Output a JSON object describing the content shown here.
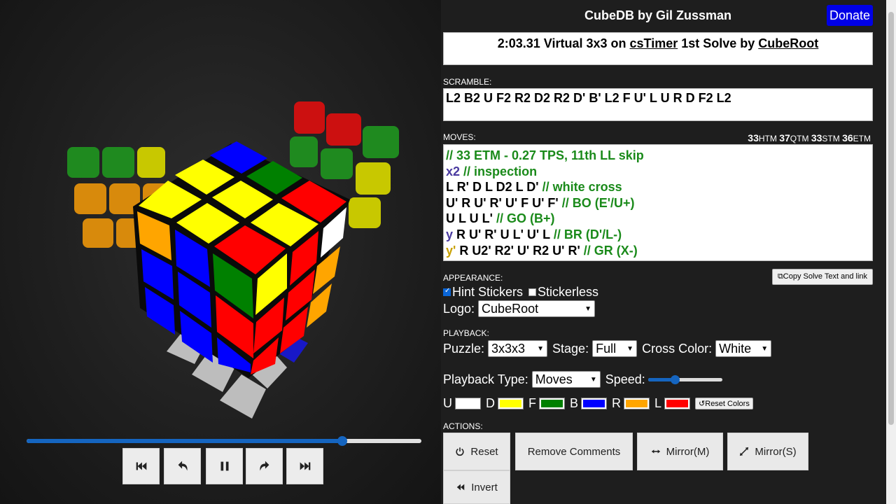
{
  "header": {
    "site_title": "CubeDB by Gil Zussman",
    "donate_label": "Donate"
  },
  "solve": {
    "title_time": "2:03.31 Virtual 3x3 on",
    "title_platform": "csTimer",
    "title_mid": "1st Solve by",
    "title_solver": "CubeRoot"
  },
  "scramble": {
    "label": "SCRAMBLE:",
    "text": "L2 B2 U F2 R2 D2 R2 D' B' L2 F U' L U R D F2 L2"
  },
  "moves": {
    "label": "MOVES:",
    "metrics": [
      {
        "value": "33",
        "unit": "HTM"
      },
      {
        "value": "37",
        "unit": "QTM"
      },
      {
        "value": "33",
        "unit": "STM"
      },
      {
        "value": "36",
        "unit": "ETM"
      }
    ],
    "lines": [
      {
        "prefix": "",
        "moves": "",
        "comment": "// 33 ETM - 0.27 TPS, 11th LL skip"
      },
      {
        "prefix": "x2",
        "moves": "",
        "comment": "// inspection"
      },
      {
        "prefix": "",
        "moves": "L R' D L D2 L D'",
        "comment": "// white cross"
      },
      {
        "prefix": "",
        "moves": "U' R U' R' U' F U' F'",
        "comment": "// BO (E'/U+)"
      },
      {
        "prefix": "",
        "moves": "U L U L'",
        "comment": "// GO (B+)"
      },
      {
        "prefix": "y",
        "moves": "R U' R' U L' U' L",
        "comment": "// BR (D'/L-)"
      },
      {
        "prefix": "y'",
        "moves": "R U2' R2' U' R2 U' R'",
        "comment": "// GR (X-)"
      }
    ]
  },
  "appearance": {
    "label": "APPEARANCE:",
    "copy_label": "Copy Solve Text and link",
    "hint_stickers_label": "Hint Stickers",
    "hint_stickers_checked": true,
    "stickerless_label": "Stickerless",
    "stickerless_checked": false,
    "logo_label": "Logo:",
    "logo_value": "CubeRoot"
  },
  "playback": {
    "label": "PLAYBACK:",
    "puzzle_label": "Puzzle:",
    "puzzle_value": "3x3x3",
    "stage_label": "Stage:",
    "stage_value": "Full",
    "cross_label": "Cross Color:",
    "cross_value": "White",
    "type_label": "Playback Type:",
    "type_value": "Moves",
    "speed_label": "Speed:",
    "speed_fraction": 0.36,
    "progress_fraction": 0.8,
    "colors": [
      {
        "face": "U",
        "hex": "#ffffff"
      },
      {
        "face": "D",
        "hex": "#ffff00"
      },
      {
        "face": "F",
        "hex": "#008000"
      },
      {
        "face": "B",
        "hex": "#0000ff"
      },
      {
        "face": "R",
        "hex": "#ffa500"
      },
      {
        "face": "L",
        "hex": "#ff0000"
      }
    ],
    "reset_colors_label": "Reset Colors"
  },
  "actions": {
    "label": "ACTIONS:",
    "reset_label": "Reset",
    "remove_comments_label": "Remove Comments",
    "mirror_m_label": "Mirror(M)",
    "mirror_s_label": "Mirror(S)",
    "invert_label": "Invert"
  },
  "colors": {
    "yellow": "#ffff00",
    "blue": "#0000ff",
    "red": "#ff0000",
    "green": "#008000",
    "orange": "#ffa500",
    "white": "#ffffff",
    "gray": "#bdbdbd",
    "accent": "#1565c0"
  }
}
